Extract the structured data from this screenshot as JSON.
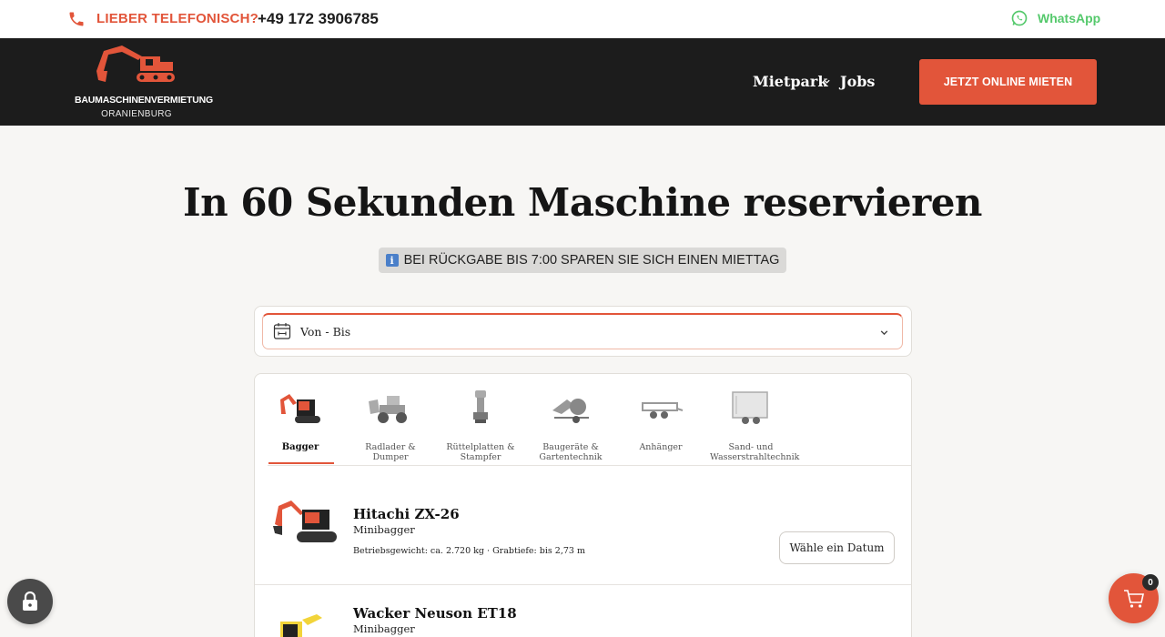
{
  "topbar": {
    "phone_label": "LIEBER TELEFONISCH?",
    "phone_number": "+49 172 3906785",
    "whatsapp_label": "WhatsApp"
  },
  "header": {
    "logo_line1": "BAUMASCHINENVERMIETUNG",
    "logo_line2": "ORANIENBURG",
    "nav": {
      "mietpark": "Mietpark",
      "jobs": "Jobs"
    },
    "cta_label": "JETZT ONLINE MIETEN"
  },
  "hero": {
    "title": "In 60 Sekunden Maschine reservieren",
    "notice_icon": "i",
    "notice": "BEI RÜCKGABE BIS 7:00 SPAREN SIE SICH EINEN MIETTAG"
  },
  "date_picker": {
    "label": "Von - Bis"
  },
  "categories": [
    {
      "label": "Bagger",
      "icon": "excavator-icon",
      "active": true
    },
    {
      "label": "Radlader & Dumper",
      "icon": "wheel-loader-icon",
      "active": false
    },
    {
      "label": "Rüttelplatten & Stampfer",
      "icon": "plate-compactor-icon",
      "active": false
    },
    {
      "label": "Baugeräte & Gartentechnik",
      "icon": "wood-chipper-icon",
      "active": false
    },
    {
      "label": "Anhänger",
      "icon": "trailer-icon",
      "active": false
    },
    {
      "label": "Sand- und Wasserstrahltechnik",
      "icon": "sandblaster-trailer-icon",
      "active": false
    }
  ],
  "items": [
    {
      "name": "Hitachi ZX-26",
      "type": "Minibagger",
      "specs": "Betriebsgewicht: ca. 2.720 kg · Grabtiefe: bis 2,73 m",
      "button": "Wähle ein Datum"
    },
    {
      "name": "Wacker Neuson ET18",
      "type": "Minibagger"
    }
  ],
  "cart": {
    "count": "0"
  },
  "colors": {
    "accent": "#e2553a",
    "header_bg": "#1c1c1c",
    "whatsapp": "#55c96c"
  }
}
